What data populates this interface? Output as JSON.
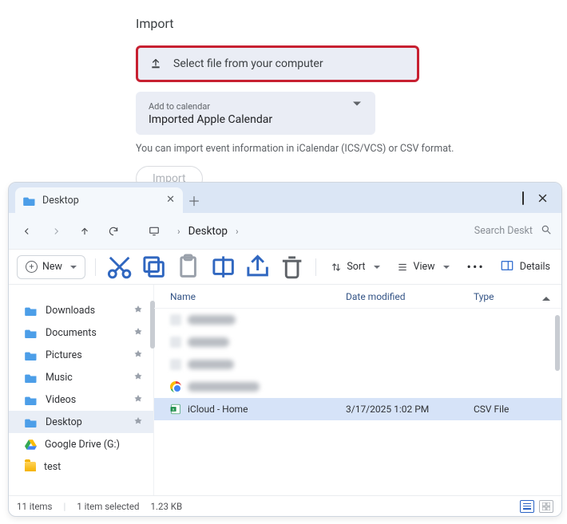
{
  "import": {
    "title": "Import",
    "select_label": "Select file from your computer",
    "add_label": "Add to calendar",
    "add_value": "Imported Apple Calendar",
    "helper": "You can import event information in iCalendar (ICS/VCS) or CSV format.",
    "button": "Import"
  },
  "explorer": {
    "tab_title": "Desktop",
    "breadcrumb": "Desktop",
    "search_placeholder": "Search Deskt",
    "toolbar": {
      "new": "New",
      "sort": "Sort",
      "view": "View",
      "details": "Details"
    },
    "headers": {
      "name": "Name",
      "date": "Date modified",
      "type": "Type"
    },
    "sidebar": {
      "items": [
        {
          "label": "Downloads"
        },
        {
          "label": "Documents"
        },
        {
          "label": "Pictures"
        },
        {
          "label": "Music"
        },
        {
          "label": "Videos"
        },
        {
          "label": "Desktop"
        },
        {
          "label": "Google Drive (G:)"
        },
        {
          "label": "test"
        }
      ]
    },
    "selected_file": {
      "name": "iCloud - Home",
      "date": "3/17/2025 1:02 PM",
      "type": "CSV File"
    },
    "status": {
      "count": "11 items",
      "selection": "1 item selected",
      "size": "1.23 KB"
    }
  }
}
